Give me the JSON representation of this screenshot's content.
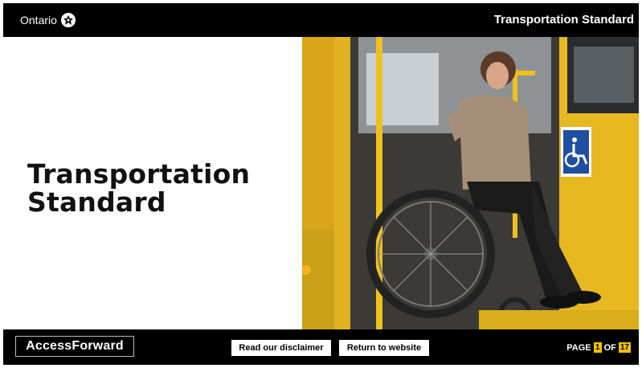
{
  "header": {
    "brand_text": "Ontario",
    "title": "Transportation Standard"
  },
  "hero": {
    "title_line1": "Transportation",
    "title_line2": "Standard",
    "image_icon": "wheelchair-accessible-bus-photo"
  },
  "footer": {
    "logo_text": "AccessForward",
    "disclaimer_label": "Read our disclaimer",
    "return_label": "Return to website",
    "page_label": "PAGE",
    "page_current": "1",
    "page_of": "OF",
    "page_total": "17"
  },
  "colors": {
    "header_bg": "#000000",
    "accent_yellow": "#f2c200",
    "bus_yellow": "#e8b820"
  }
}
